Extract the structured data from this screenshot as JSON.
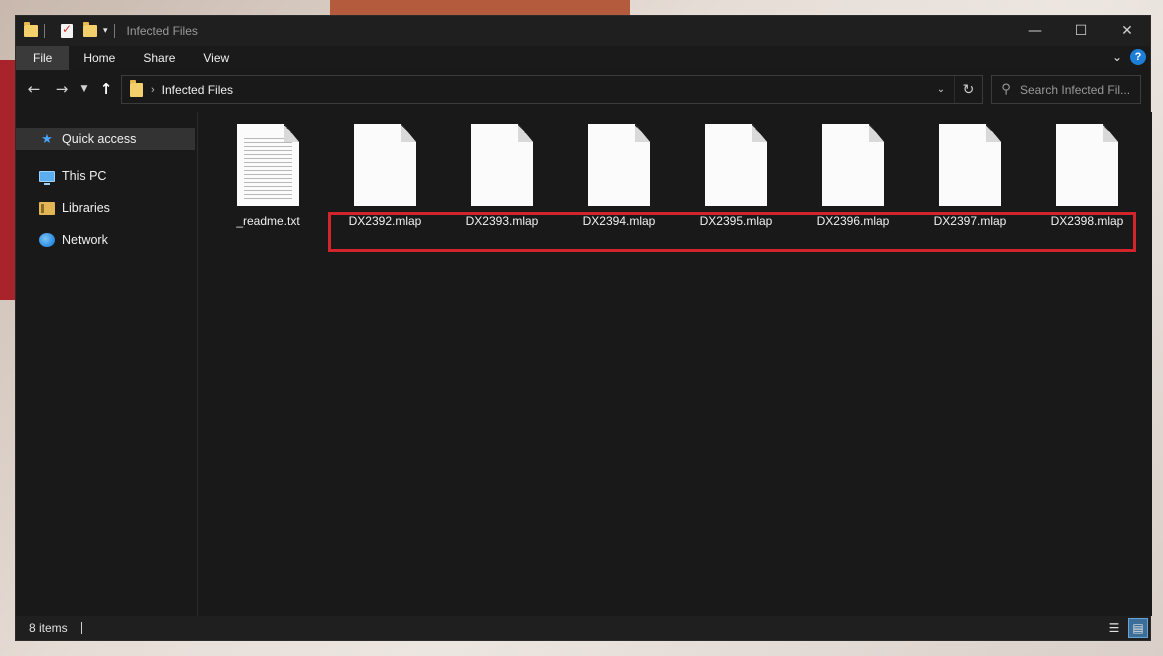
{
  "window": {
    "title": "Infected Files",
    "controls": {
      "minimize": "—",
      "maximize": "☐",
      "close": "✕"
    }
  },
  "ribbon": {
    "tabs": [
      "File",
      "Home",
      "Share",
      "View"
    ],
    "help": "?"
  },
  "address": {
    "crumb": "Infected Files",
    "search_placeholder": "Search Infected Fil..."
  },
  "sidebar": {
    "items": [
      {
        "label": "Quick access",
        "icon": "star-icon"
      },
      {
        "label": "This PC",
        "icon": "computer-icon"
      },
      {
        "label": "Libraries",
        "icon": "libraries-icon"
      },
      {
        "label": "Network",
        "icon": "network-icon"
      }
    ]
  },
  "files": [
    {
      "name": "_readme.txt",
      "type": "txt"
    },
    {
      "name": "DX2392.mlap",
      "type": "blank"
    },
    {
      "name": "DX2393.mlap",
      "type": "blank"
    },
    {
      "name": "DX2394.mlap",
      "type": "blank"
    },
    {
      "name": "DX2395.mlap",
      "type": "blank"
    },
    {
      "name": "DX2396.mlap",
      "type": "blank"
    },
    {
      "name": "DX2397.mlap",
      "type": "blank"
    },
    {
      "name": "DX2398.mlap",
      "type": "blank"
    }
  ],
  "status": {
    "count": "8 items"
  },
  "colors": {
    "highlight": "#d2242c",
    "background": "#191919",
    "accent": "#1c7ed6"
  }
}
